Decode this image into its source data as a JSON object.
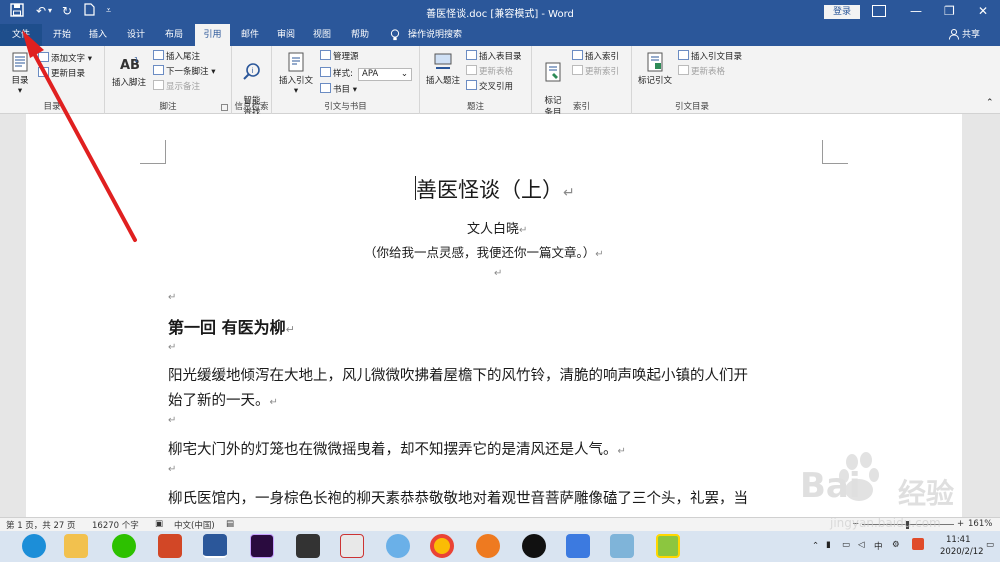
{
  "titlebar": {
    "doc_title": "善医怪谈.doc [兼容模式] - Word",
    "login": "登录"
  },
  "tabs": [
    {
      "label": "文件",
      "key": "file"
    },
    {
      "label": "开始",
      "key": "home"
    },
    {
      "label": "插入",
      "key": "insert"
    },
    {
      "label": "设计",
      "key": "design"
    },
    {
      "label": "布局",
      "key": "layout"
    },
    {
      "label": "引用",
      "key": "references"
    },
    {
      "label": "邮件",
      "key": "mailings"
    },
    {
      "label": "审阅",
      "key": "review"
    },
    {
      "label": "视图",
      "key": "view"
    },
    {
      "label": "帮助",
      "key": "help"
    }
  ],
  "tell_me": "操作说明搜索",
  "share": "共享",
  "ribbon": {
    "toc": {
      "label": "目录",
      "add_text": "添加文字",
      "update": "更新目录",
      "group": "目录"
    },
    "footnotes": {
      "insert_footnote": "插入脚注",
      "insert_endnote": "插入尾注",
      "next_footnote": "下一条脚注",
      "show_notes": "显示备注",
      "group": "脚注"
    },
    "research": {
      "smart_lookup": "智能\n查找",
      "group": "信息检索"
    },
    "citations": {
      "insert_citation": "插入引文",
      "manage_sources": "管理源",
      "style_label": "样式:",
      "style_value": "APA",
      "bibliography": "书目",
      "group": "引文与书目"
    },
    "captions": {
      "insert_caption": "插入题注",
      "insert_tof": "插入表目录",
      "update_table": "更新表格",
      "cross_ref": "交叉引用",
      "group": "题注"
    },
    "index": {
      "mark_entry": "标记\n条目",
      "insert_index": "插入索引",
      "update_index": "更新索引",
      "group": "索引"
    },
    "toa": {
      "mark_citation": "标记引文",
      "insert_toa": "插入引文目录",
      "update_toa": "更新表格",
      "group": "引文目录"
    }
  },
  "document": {
    "title": "善医怪谈（上）",
    "author": "文人白晓",
    "subtitle": "（你给我一点灵感，我便还你一篇文章。）",
    "chapter": "第一回  有医为柳",
    "para1_line1": "阳光缓缓地倾泻在大地上，风儿微微吹拂着屋檐下的风竹铃，清脆的响声唤起小镇的人们开",
    "para1_line2": "始了新的一天。",
    "para2": "柳宅大门外的灯笼也在微微摇曳着，却不知摆弄它的是清风还是人气。",
    "para3": "柳氏医馆内，一身棕色长袍的柳天素恭恭敬敬地对着观世音菩萨雕像磕了三个头，礼罢，当",
    "para_mark": "↵"
  },
  "status": {
    "page": "第 1 页，共 27 页",
    "words": "16270 个字",
    "language": "中文(中国)",
    "zoom": "161%",
    "minus": "−",
    "plus": "+"
  },
  "taskbar": {
    "time": "11:41",
    "date": "2020/2/12"
  },
  "watermark": {
    "brand": "Bai",
    "brand_cn": "经验",
    "url": "jingyan.baidu.com"
  },
  "colors": {
    "word_blue": "#2b579a",
    "arrow_red": "#e02020"
  }
}
